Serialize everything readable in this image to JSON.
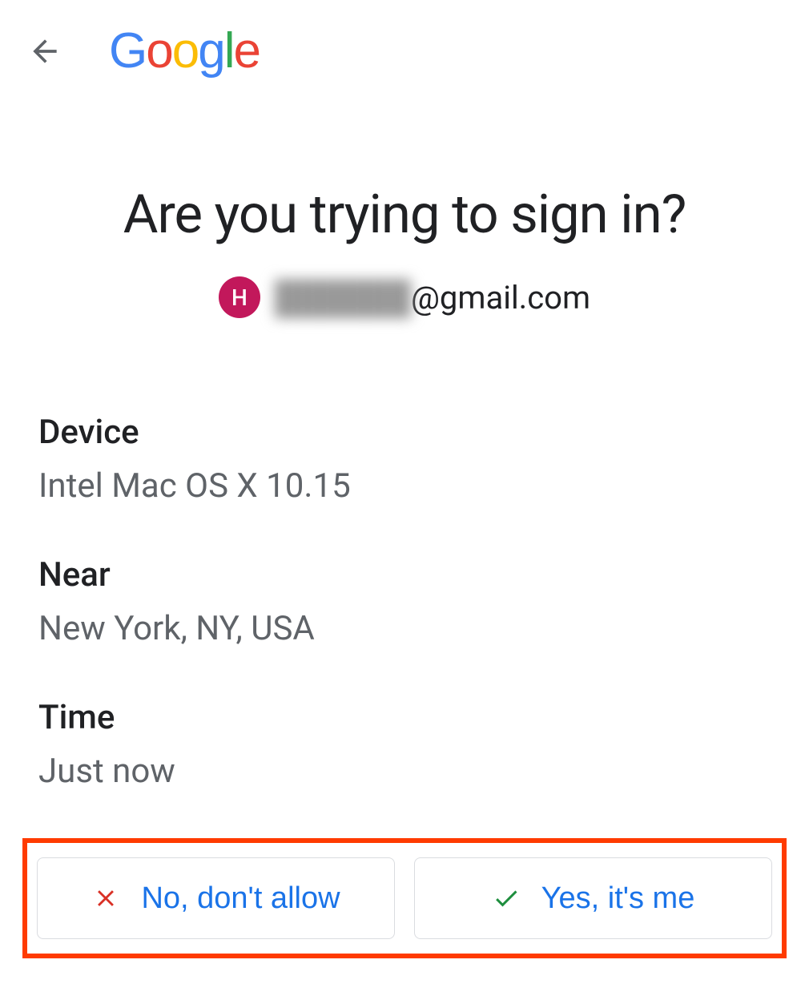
{
  "logo_text": "Google",
  "title": "Are you trying to sign in?",
  "avatar_letter": "H",
  "email_prefix_hidden": "██████",
  "email_suffix": "@gmail.com",
  "details": {
    "device_label": "Device",
    "device_value": "Intel Mac OS X 10.15",
    "near_label": "Near",
    "near_value": "New York, NY, USA",
    "time_label": "Time",
    "time_value": "Just now"
  },
  "buttons": {
    "deny_label": "No, don't allow",
    "allow_label": "Yes, it's me"
  },
  "colors": {
    "highlight_box": "#ff3b00",
    "link_blue": "#1a73e8",
    "x_red": "#d93025",
    "check_green": "#1e8e3e"
  }
}
